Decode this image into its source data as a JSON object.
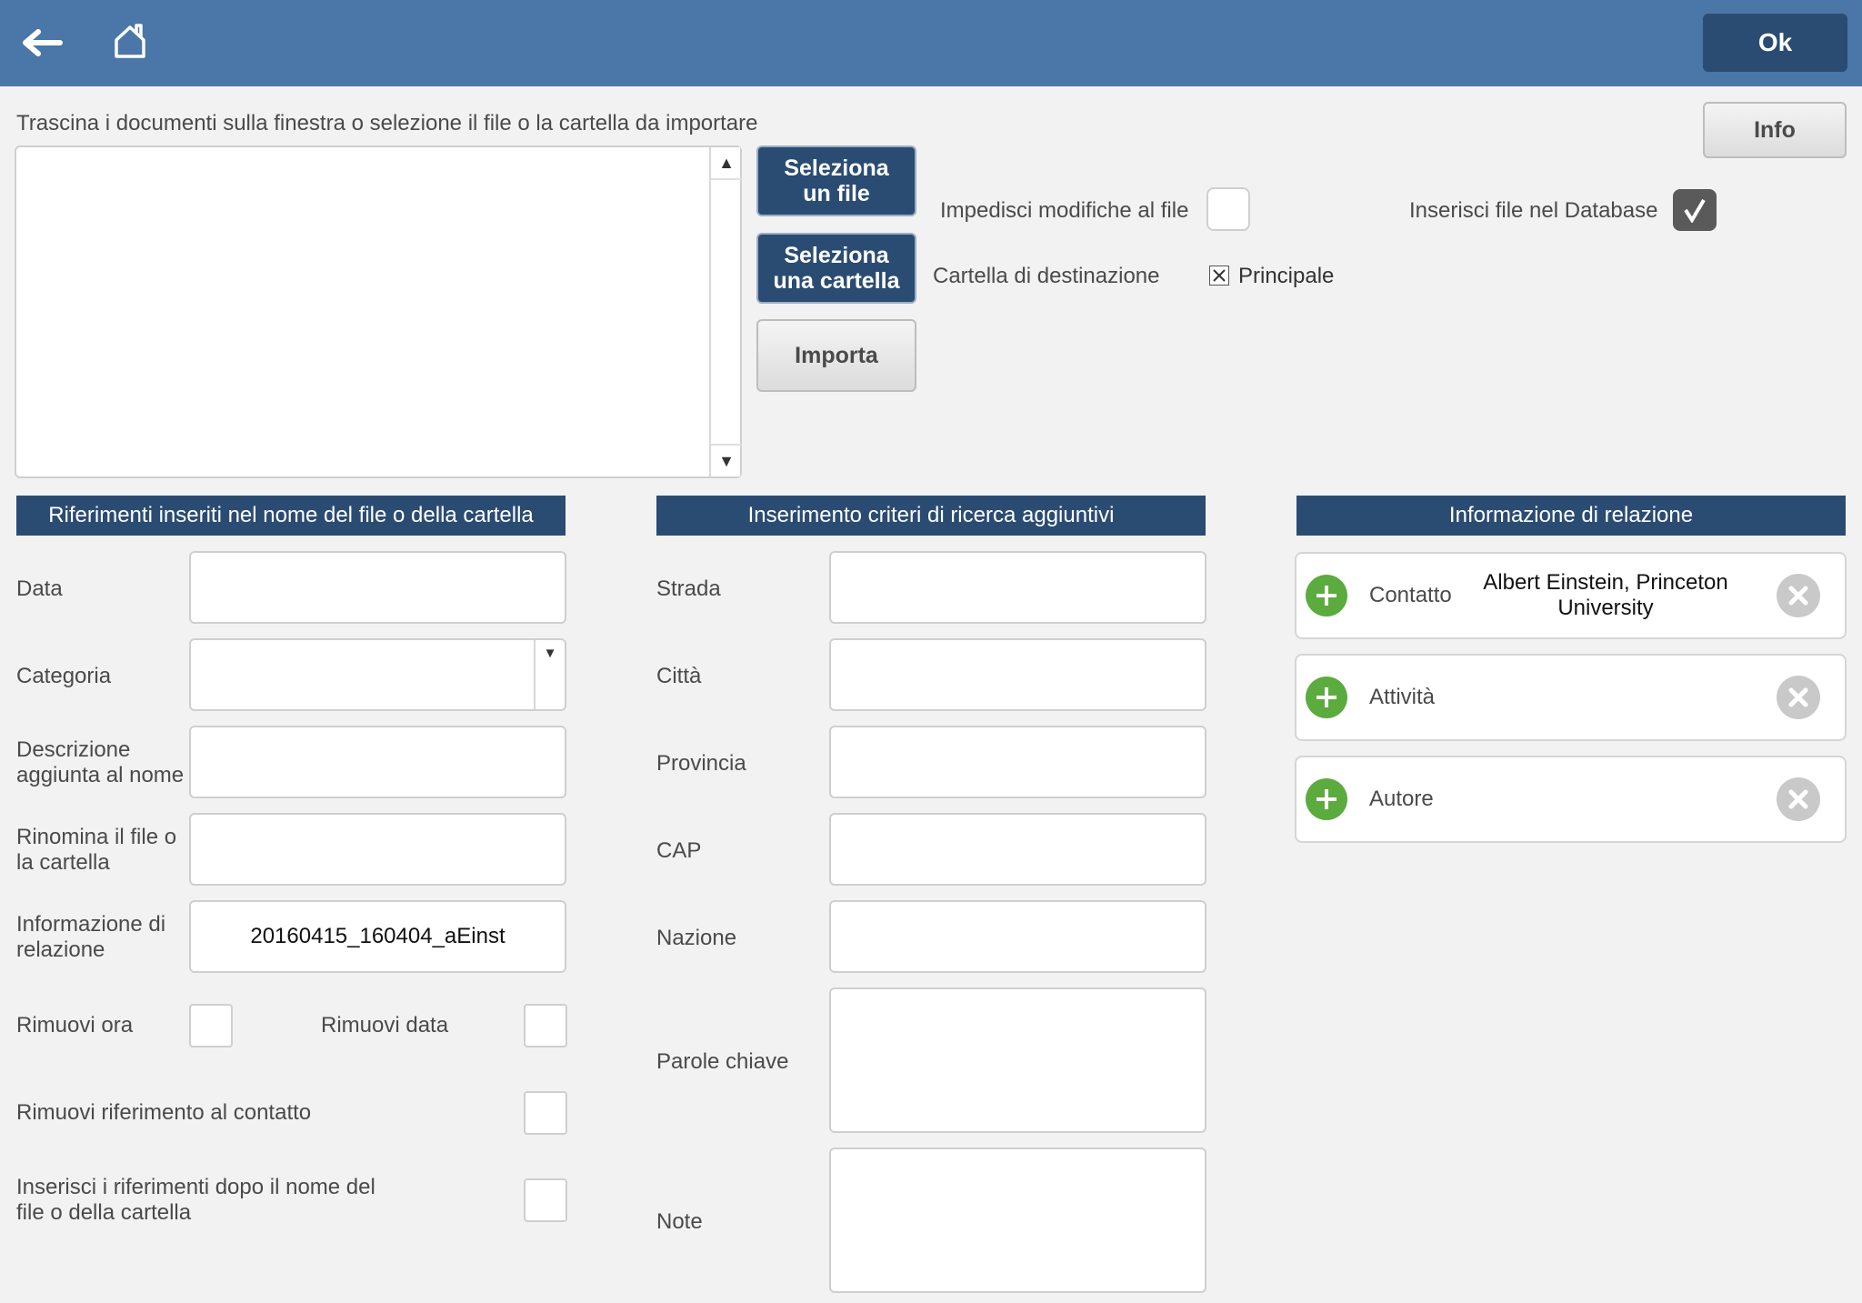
{
  "toolbar": {
    "ok_label": "Ok"
  },
  "info_label": "Info",
  "import": {
    "instruction": "Trascina i documenti sulla finestra o selezione il file o la cartella da importare",
    "select_file_label_1": "Seleziona",
    "select_file_label_2": "un file",
    "select_folder_label_1": "Seleziona",
    "select_folder_label_2": "una cartella",
    "import_label": "Importa",
    "prevent_edit_label": "Impedisci modifiche al file",
    "insert_db_label": "Inserisci file nel Database",
    "insert_db_checked": true,
    "dest_folder_label": "Cartella di destinazione",
    "dest_folder_value": "Principale",
    "dest_folder_checked": true
  },
  "references": {
    "title": "Riferimenti inseriti nel nome del file o della cartella",
    "data_label": "Data",
    "category_label": "Categoria",
    "desc_label_1": "Descrizione",
    "desc_label_2": "aggiunta al nome",
    "rename_label_1": "Rinomina il file o",
    "rename_label_2": "la cartella",
    "relinfo_label_1": "Informazione di",
    "relinfo_label_2": "relazione",
    "relinfo_value": "20160415_160404_aEinst",
    "remove_time_label": "Rimuovi ora",
    "remove_date_label": "Rimuovi data",
    "remove_contact_label": "Rimuovi riferimento al contatto",
    "insert_after_label_1": "Inserisci i riferimenti dopo il nome del",
    "insert_after_label_2": "file o della cartella"
  },
  "criteria": {
    "title": "Inserimento criteri di ricerca aggiuntivi",
    "street_label": "Strada",
    "city_label": "Città",
    "province_label": "Provincia",
    "cap_label": "CAP",
    "nation_label": "Nazione",
    "keywords_label": "Parole chiave",
    "notes_label": "Note"
  },
  "relation": {
    "title": "Informazione di relazione",
    "contact_label": "Contatto",
    "contact_value_1": "Albert Einstein, Princeton",
    "contact_value_2": "University",
    "activity_label": "Attività",
    "author_label": "Autore"
  },
  "colors": {
    "header": "#4a76a8",
    "dark_button": "#2b4c72",
    "add_green": "#5bab3e",
    "remove_gray": "#c9c9c9"
  }
}
